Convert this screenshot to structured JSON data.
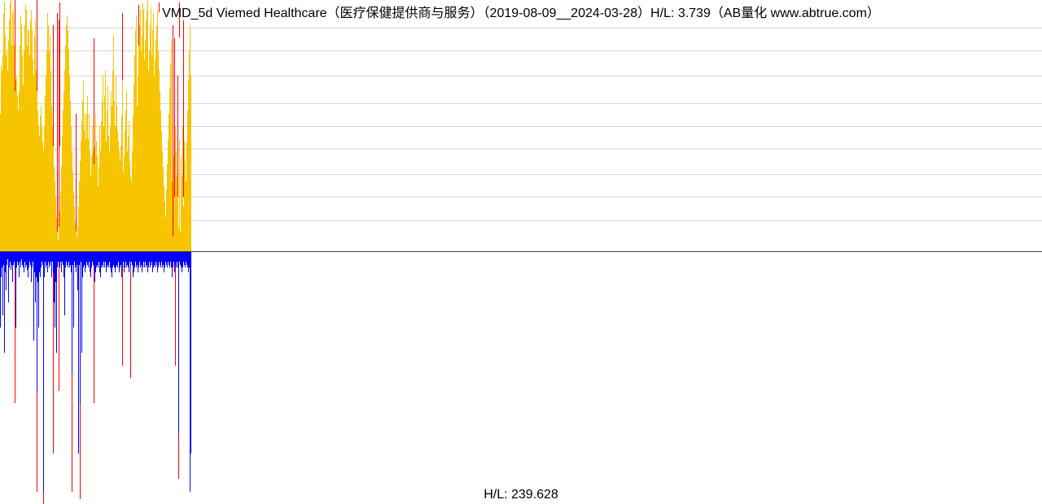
{
  "title": "VMD_5d Viemed Healthcare（医疗保健提供商与服务）（2019-08-09__2024-03-28）H/L: 3.739（AB量化  www.abtrue.com）",
  "footer": "H/L: 239.628",
  "chart_data": {
    "type": "bar",
    "title": "VMD_5d Viemed Healthcare（医疗保健提供商与服务）（2019-08-09__2024-03-28）H/L: 3.739（AB量化  www.abtrue.com）",
    "xlabel": "",
    "ylabel": "",
    "x_range_dates": [
      "2019-08-09",
      "2024-03-28"
    ],
    "upper_panel": {
      "description": "Yellow upward bars (values read as fraction of panel height, 0..1, baseline at 0). Dense series of ~235 points shown only in left ~235px region; rest empty.",
      "ylim_note": "Top of panel corresponds to H/L ratio 3.739",
      "grid_fracs": [
        0.125,
        0.22,
        0.31,
        0.41,
        0.5,
        0.59,
        0.7,
        0.8,
        0.89
      ],
      "series": [
        {
          "name": "price H/L (yellow)",
          "color": "#f7c500",
          "values_frac": [
            0.55,
            0.74,
            0.72,
            0.78,
            0.95,
            0.99,
            0.86,
            0.78,
            0.8,
            0.72,
            0.84,
            0.92,
            0.99,
            1.0,
            0.82,
            0.95,
            0.96,
            0.82,
            0.64,
            0.68,
            0.7,
            0.62,
            0.56,
            0.64,
            0.82,
            0.94,
            0.9,
            0.78,
            0.66,
            0.8,
            0.9,
            0.98,
            0.96,
            0.82,
            0.88,
            0.88,
            0.78,
            0.92,
            0.96,
            0.88,
            0.76,
            0.7,
            0.86,
            0.92,
            0.72,
            0.64,
            0.56,
            0.5,
            0.46,
            0.54,
            0.58,
            0.5,
            0.44,
            0.4,
            0.5,
            0.62,
            0.7,
            0.8,
            0.95,
            0.9,
            0.8,
            0.86,
            0.72,
            0.58,
            0.5,
            0.42,
            0.34,
            0.28,
            0.22,
            0.14,
            0.08,
            0.05,
            0.1,
            0.16,
            0.24,
            0.34,
            0.46,
            0.56,
            0.64,
            0.72,
            0.82,
            0.9,
            0.94,
            0.88,
            0.8,
            0.7,
            0.6,
            0.5,
            0.4,
            0.32,
            0.24,
            0.18,
            0.12,
            0.08,
            0.06,
            0.1,
            0.18,
            0.28,
            0.36,
            0.44,
            0.52,
            0.6,
            0.68,
            0.48,
            0.55,
            0.45,
            0.55,
            0.62,
            0.45,
            0.55,
            0.4,
            0.3,
            0.38,
            0.5,
            0.4,
            0.35,
            0.42,
            0.55,
            0.44,
            0.38,
            0.26,
            0.34,
            0.5,
            0.4,
            0.52,
            0.6,
            0.7,
            0.5,
            0.62,
            0.72,
            0.44,
            0.56,
            0.66,
            0.46,
            0.4,
            0.5,
            0.64,
            0.58,
            0.72,
            0.86,
            0.6,
            0.5,
            0.7,
            0.58,
            0.48,
            0.44,
            0.4,
            0.36,
            0.42,
            0.54,
            0.68,
            0.32,
            0.38,
            0.48,
            0.56,
            0.64,
            0.4,
            0.46,
            0.52,
            0.36,
            0.3,
            0.28,
            0.4,
            0.54,
            0.66,
            0.78,
            0.88,
            0.94,
            0.58,
            0.7,
            0.82,
            0.9,
            0.96,
            0.8,
            0.86,
            0.99,
            0.96,
            0.76,
            0.84,
            0.92,
            0.96,
            1.0,
            0.72,
            0.8,
            0.9,
            0.97,
            0.78,
            0.88,
            0.95,
            0.7,
            0.76,
            0.84,
            0.9,
            0.96,
            0.8,
            0.72,
            0.64,
            0.56,
            0.48,
            0.4,
            0.34,
            0.26,
            0.2,
            0.14,
            0.25,
            0.35,
            0.45,
            0.55,
            0.65,
            0.75,
            0.84,
            0.28,
            0.06,
            0.38,
            0.22,
            0.5,
            0.4,
            0.3,
            0.22,
            0.1,
            0.45,
            0.08,
            0.38,
            0.3,
            0.5,
            0.18,
            0.44,
            0.36,
            0.28,
            0.44,
            0.56,
            0.68,
            0.8,
            0.9,
            0.7
          ]
        },
        {
          "name": "red markers upper",
          "color": "#ff0000",
          "marker_indices": [
            18,
            45,
            65,
            70,
            72,
            73,
            93,
            115,
            150,
            170,
            175,
            195,
            212,
            214,
            218,
            220,
            225
          ],
          "marker_span_frac": [
            [
              0.18,
              1.0
            ],
            [
              0.38,
              1.0
            ],
            [
              0.18,
              0.9
            ],
            [
              0.05,
              0.95
            ],
            [
              0.0,
              0.92
            ],
            [
              0.42,
              0.99
            ],
            [
              0.02,
              0.55
            ],
            [
              0.05,
              0.85
            ],
            [
              0.1,
              0.95
            ],
            [
              0.1,
              0.98
            ],
            [
              0.3,
              0.98
            ],
            [
              0.95,
              0.99
            ],
            [
              0.05,
              0.9
            ],
            [
              0.1,
              0.85
            ],
            [
              0.0,
              0.7
            ],
            [
              0.85,
              0.99
            ],
            [
              0.22,
              0.92
            ]
          ]
        }
      ]
    },
    "lower_panel": {
      "description": "Blue downward bars from top baseline (values as fraction of panel height).",
      "ylim_note": "Bottom corresponds to H/L 239.628",
      "series": [
        {
          "name": "volume H/L (blue)",
          "color": "#0000ff",
          "values_frac": [
            0.3,
            0.1,
            0.06,
            0.25,
            0.05,
            0.4,
            0.08,
            0.15,
            0.05,
            0.03,
            0.2,
            0.06,
            0.04,
            0.07,
            0.05,
            0.12,
            0.05,
            0.04,
            0.06,
            0.3,
            0.06,
            0.04,
            0.05,
            0.1,
            0.04,
            0.06,
            0.03,
            0.05,
            0.06,
            0.08,
            0.04,
            0.06,
            0.05,
            0.07,
            0.1,
            0.06,
            0.04,
            0.05,
            0.12,
            0.06,
            0.04,
            0.35,
            0.08,
            0.2,
            0.1,
            0.55,
            0.12,
            0.3,
            0.08,
            0.1,
            0.06,
            0.04,
            0.05,
            0.95,
            0.1,
            0.04,
            0.06,
            0.05,
            0.08,
            0.04,
            0.06,
            0.05,
            0.04,
            0.1,
            0.04,
            0.08,
            0.2,
            0.3,
            0.12,
            0.4,
            0.06,
            0.04,
            0.05,
            0.06,
            0.04,
            0.08,
            0.04,
            0.05,
            0.1,
            0.25,
            0.06,
            0.04,
            0.05,
            0.06,
            0.04,
            0.06,
            0.05,
            0.08,
            0.48,
            0.05,
            0.3,
            0.04,
            0.06,
            0.08,
            0.05,
            0.15,
            0.8,
            0.05,
            0.6,
            0.04,
            0.4,
            0.1,
            0.06,
            0.05,
            0.08,
            0.06,
            0.04,
            0.05,
            0.06,
            0.04,
            0.08,
            0.1,
            0.06,
            0.04,
            0.05,
            0.06,
            0.12,
            0.08,
            0.06,
            0.05,
            0.06,
            0.04,
            0.08,
            0.1,
            0.06,
            0.05,
            0.06,
            0.04,
            0.06,
            0.04,
            0.08,
            0.06,
            0.05,
            0.06,
            0.04,
            0.06,
            0.08,
            0.1,
            0.06,
            0.05,
            0.06,
            0.08,
            0.06,
            0.05,
            0.06,
            0.04,
            0.08,
            0.06,
            0.05,
            0.1,
            0.06,
            0.04,
            0.08,
            0.06,
            0.04,
            0.06,
            0.05,
            0.06,
            0.08,
            0.04,
            0.06,
            0.04,
            0.05,
            0.1,
            0.08,
            0.06,
            0.04,
            0.06,
            0.05,
            0.08,
            0.06,
            0.04,
            0.06,
            0.05,
            0.08,
            0.06,
            0.04,
            0.06,
            0.04,
            0.06,
            0.05,
            0.08,
            0.06,
            0.04,
            0.06,
            0.05,
            0.04,
            0.08,
            0.06,
            0.05,
            0.06,
            0.04,
            0.05,
            0.08,
            0.06,
            0.04,
            0.05,
            0.06,
            0.04,
            0.06,
            0.05,
            0.08,
            0.06,
            0.04,
            0.05,
            0.06,
            0.04,
            0.05,
            0.06,
            0.04,
            0.06,
            0.1,
            0.06,
            0.04,
            0.08,
            0.05,
            0.06,
            0.04,
            0.06,
            0.72,
            0.04,
            0.05,
            0.06,
            0.08,
            0.06,
            0.04,
            0.05,
            0.06,
            0.04,
            0.05,
            0.06,
            0.08,
            0.06,
            0.95,
            0.8
          ]
        },
        {
          "name": "red markers lower",
          "color": "#ff0000",
          "marker_indices": [
            18,
            45,
            53,
            65,
            72,
            88,
            98,
            115,
            150,
            160,
            215,
            219,
            233
          ],
          "marker_span_frac": [
            [
              0.0,
              0.6
            ],
            [
              0.0,
              0.95
            ],
            [
              0.0,
              1.0
            ],
            [
              0.0,
              0.8
            ],
            [
              0.0,
              0.55
            ],
            [
              0.0,
              0.95
            ],
            [
              0.0,
              0.98
            ],
            [
              0.0,
              0.6
            ],
            [
              0.0,
              0.45
            ],
            [
              0.0,
              0.5
            ],
            [
              0.0,
              0.45
            ],
            [
              0.0,
              0.9
            ],
            [
              0.0,
              0.95
            ]
          ]
        }
      ]
    }
  }
}
